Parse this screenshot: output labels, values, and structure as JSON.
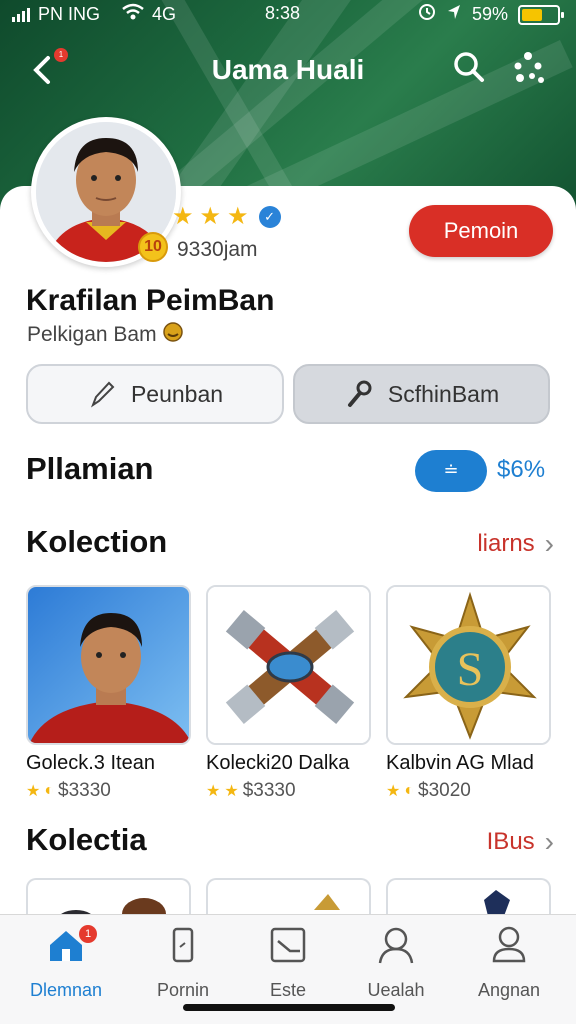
{
  "status_bar": {
    "carrier": "PN ING",
    "network": "4G",
    "time": "8:38",
    "battery": "59%",
    "battery_level": 0.59
  },
  "header": {
    "title": "Uama Huali",
    "back_badge": "1"
  },
  "profile": {
    "level": "10",
    "stars": 3,
    "hours": "9330jam",
    "name": "Krafilan PeimBan",
    "subtitle": "Pelkigan Bam",
    "primary_button": "Pemoin"
  },
  "actions": [
    {
      "label": "Peunban",
      "icon": "pencil-icon"
    },
    {
      "label": "ScfhinBam",
      "icon": "wrench-icon"
    }
  ],
  "plan": {
    "title": "Pllamian",
    "toggle_label": "≐",
    "value": "$6%"
  },
  "collection": {
    "title": "Kolection",
    "see_all": "liarns",
    "items": [
      {
        "title": "Goleck.3 Itean",
        "price": "$3330"
      },
      {
        "title": "Kolecki20 Dalka",
        "price": "$3330"
      },
      {
        "title": "Kalbvin AG Mlad",
        "price": "$3020"
      }
    ]
  },
  "collection2": {
    "title": "Kolectia",
    "see_all": "IBus"
  },
  "tabbar": {
    "items": [
      {
        "label": "Dlemnan",
        "icon": "home-icon",
        "badge": "1"
      },
      {
        "label": "Pornin",
        "icon": "phone-icon"
      },
      {
        "label": "Este",
        "icon": "chart-icon"
      },
      {
        "label": "Uealah",
        "icon": "user-outline-icon"
      },
      {
        "label": "Angnan",
        "icon": "profile-icon"
      }
    ]
  },
  "colors": {
    "header_green": "#1e6b40",
    "accent_red": "#d92f26",
    "accent_blue": "#1e7fd1",
    "star_gold": "#f4b712"
  }
}
